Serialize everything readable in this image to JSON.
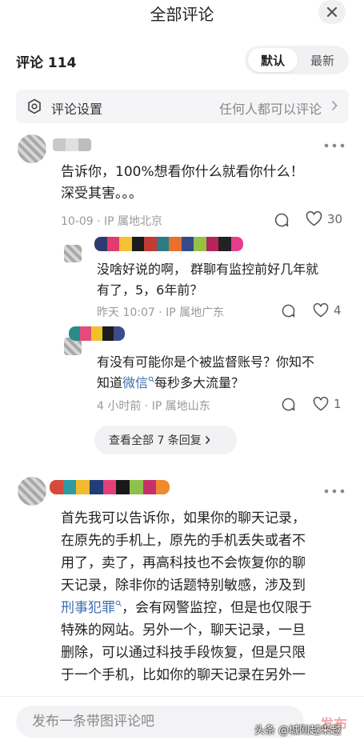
{
  "header": {
    "title": "全部评论",
    "close_icon": "close-icon"
  },
  "count_row": {
    "label": "评论 114",
    "sort_options": [
      {
        "label": "默认",
        "active": true
      },
      {
        "label": "最新",
        "active": false
      }
    ]
  },
  "settings": {
    "icon": "settings-hexagon-icon",
    "label": "评论设置",
    "value": "任何人都可以评论",
    "chevron": "chevron-right-icon"
  },
  "comments": [
    {
      "line1": "告诉你，100%想看你什么就看你什么！",
      "line2": "深受其害。。。",
      "meta": "10-09 · IP 属地北京",
      "likes": "30",
      "replies": [
        {
          "line1": "没啥好说的啊， 群聊有监控前好几年就",
          "line2": "有了，5，6年前？",
          "meta": "昨天 10:07 · IP 属地广东",
          "likes": "4"
        },
        {
          "line1": "有没有可能你是个被监督账号？你知不",
          "line2_prefix": "知道",
          "line2_link": "微信",
          "line2_suffix": "每秒多大流量？",
          "meta": "4 小时前 · IP 属地山东",
          "likes": "1"
        }
      ],
      "view_all": "查看全部 7 条回复"
    },
    {
      "lines": [
        "首先我可以告诉你，如果你的聊天记录，",
        "在原先的手机上，原先的手机丢失或者不",
        "用了，卖了，再高科技也不会恢复你的聊",
        "天记录，除非你的话题特别敏感，涉及到"
      ],
      "link_line_link": "刑事犯罪",
      "link_line_suffix": "，会有网警监控，但是也仅限于",
      "more_lines": [
        "特殊的网站。另外一个，聊天记录，一旦",
        "删除，可以通过科技手段恢复，但是只限",
        "于一个手机，比如你的聊天记录在另外一"
      ]
    }
  ],
  "bottom": {
    "placeholder": "发布一条带图评论吧",
    "send_label": "发布",
    "watermark": "头条 @城刚越来越"
  },
  "colors": {
    "link": "#3d6fb3",
    "send_disabled": "#f3a6a6"
  }
}
